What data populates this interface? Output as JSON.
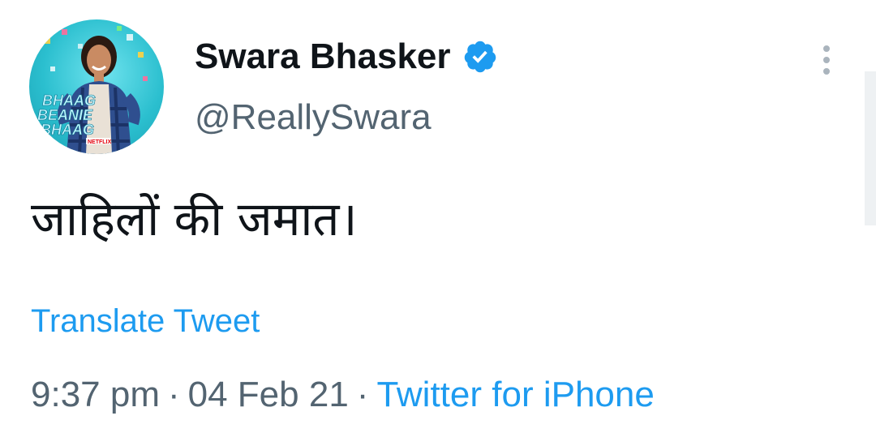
{
  "user": {
    "display_name": "Swara Bhasker",
    "handle": "@ReallySwara",
    "verified": true,
    "avatar_icon": "profile-photo"
  },
  "avatar_poster": {
    "lines": [
      "BHAAG",
      "BEANIE",
      "BHAAG"
    ],
    "badge": "NETFLIX"
  },
  "tweet": {
    "text": "जाहिलों की जमात।"
  },
  "actions": {
    "translate_label": "Translate Tweet",
    "more_icon": "more-vertical-icon"
  },
  "meta": {
    "time": "9:37 pm",
    "separator": "·",
    "date": "04 Feb 21",
    "source": "Twitter for iPhone"
  },
  "colors": {
    "link": "#1d9bf0",
    "secondary_text": "#536471",
    "primary_text": "#0f1419",
    "verified_badge": "#1d9bf0"
  }
}
